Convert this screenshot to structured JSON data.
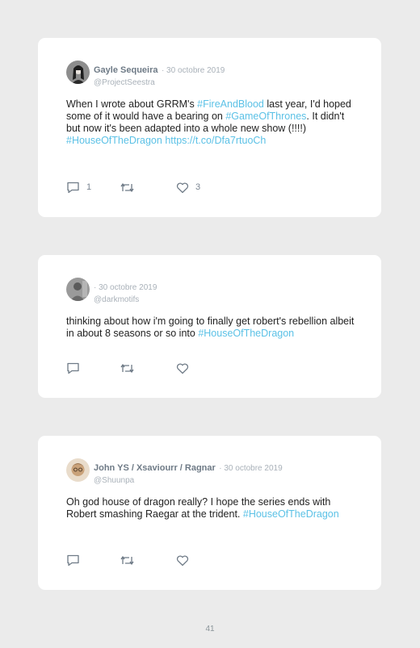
{
  "tweets": [
    {
      "author_name": "Gayle Sequeira",
      "date": "· 30 octobre 2019",
      "handle": "@ProjectSeestra",
      "text_1": "When I wrote about GRRM's ",
      "tag_1": "#FireAndBlood",
      "text_2": " last year, I'd hoped some of it would have a bearing on ",
      "tag_2": "#GameOfThrones",
      "text_3": ". It didn't but now it's been adapted into a whole new show (!!!!) ",
      "tag_3": "#HouseOfTheDragon",
      "text_4": " ",
      "link": "https://t.co/Dfa7rtuoCh",
      "reply_count": "1",
      "retweet_count": "",
      "like_count": "3"
    },
    {
      "author_name": "",
      "date": "· 30 octobre 2019",
      "handle": "@darkmotifs",
      "text_1": "thinking about how i'm going to finally get robert's rebellion albeit in about 8 seasons or so into ",
      "tag_1": "#HouseOfTheDragon",
      "reply_count": "",
      "retweet_count": "",
      "like_count": ""
    },
    {
      "author_name": "John YS / Xsaviourr / Ragnar",
      "date": "· 30 octobre 2019",
      "handle": "@Shuunpa",
      "text_1": "Oh god house of dragon really? I hope the series ends with Robert smashing Raegar at the trident. ",
      "tag_1": "#HouseOfTheDragon",
      "reply_count": "",
      "retweet_count": "",
      "like_count": ""
    }
  ],
  "icons": [
    "reply-icon",
    "retweet-icon",
    "like-icon"
  ],
  "colors": {
    "hashtag": "#5bc1e6",
    "background": "#ebebeb",
    "card": "#ffffff"
  },
  "page_number": "41"
}
